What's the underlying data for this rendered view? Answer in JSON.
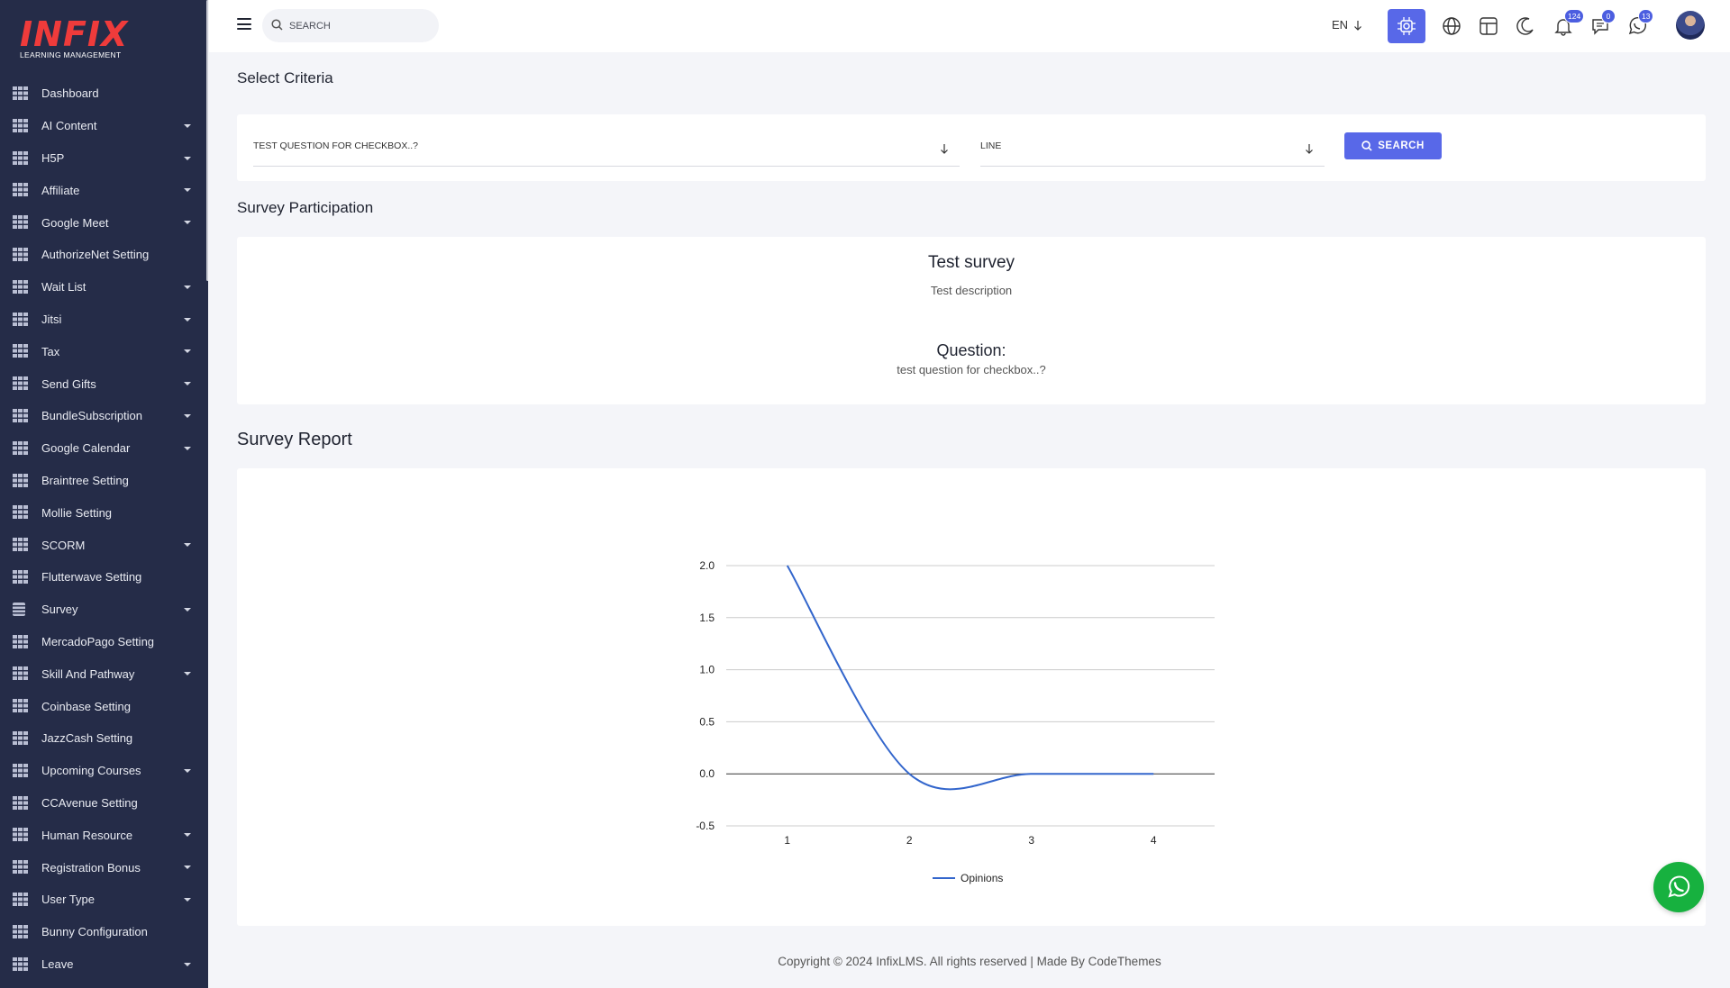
{
  "logo": {
    "brand": "INFIX",
    "tagline": "LEARNING MANAGEMENT"
  },
  "sidebar": {
    "items": [
      {
        "label": "Dashboard",
        "caret": false
      },
      {
        "label": "AI Content",
        "caret": true
      },
      {
        "label": "H5P",
        "caret": true
      },
      {
        "label": "Affiliate",
        "caret": true
      },
      {
        "label": "Google Meet",
        "caret": true
      },
      {
        "label": "AuthorizeNet Setting",
        "caret": false
      },
      {
        "label": "Wait List",
        "caret": true
      },
      {
        "label": "Jitsi",
        "caret": true
      },
      {
        "label": "Tax",
        "caret": true
      },
      {
        "label": "Send Gifts",
        "caret": true
      },
      {
        "label": "BundleSubscription",
        "caret": true
      },
      {
        "label": "Google Calendar",
        "caret": true
      },
      {
        "label": "Braintree Setting",
        "caret": false
      },
      {
        "label": "Mollie Setting",
        "caret": false
      },
      {
        "label": "SCORM",
        "caret": true
      },
      {
        "label": "Flutterwave Setting",
        "caret": false
      },
      {
        "label": "Survey",
        "caret": true,
        "icon": "doc"
      },
      {
        "label": "MercadoPago Setting",
        "caret": false
      },
      {
        "label": "Skill And Pathway",
        "caret": true
      },
      {
        "label": "Coinbase Setting",
        "caret": false
      },
      {
        "label": "JazzCash Setting",
        "caret": false
      },
      {
        "label": "Upcoming Courses",
        "caret": true
      },
      {
        "label": "CCAvenue Setting",
        "caret": false
      },
      {
        "label": "Human Resource",
        "caret": true
      },
      {
        "label": "Registration Bonus",
        "caret": true
      },
      {
        "label": "User Type",
        "caret": true
      },
      {
        "label": "Bunny Configuration",
        "caret": false
      },
      {
        "label": "Leave",
        "caret": true
      }
    ]
  },
  "topbar": {
    "search_placeholder": "SEARCH",
    "language": "EN",
    "notifications_count": "124",
    "messages_count": "0",
    "whatsapp_count": "13"
  },
  "criteria": {
    "title": "Select Criteria",
    "question_select": "TEST QUESTION FOR CHECKBOX..?",
    "chart_type_select": "LINE",
    "search_label": "SEARCH"
  },
  "participation": {
    "title": "Survey Participation",
    "survey_title": "Test survey",
    "survey_description": "Test description",
    "question_label": "Question:",
    "question_text": "test question for checkbox..?"
  },
  "report": {
    "title": "Survey Report"
  },
  "chart_data": {
    "type": "line",
    "x": [
      1,
      2,
      3,
      4
    ],
    "series": [
      {
        "name": "Opinions",
        "values": [
          2,
          0,
          0,
          0
        ],
        "color": "#3366cc"
      }
    ],
    "ylim": [
      -0.5,
      2.0
    ],
    "yticks": [
      "2.0",
      "1.5",
      "1.0",
      "0.5",
      "0.0",
      "-0.5"
    ],
    "xticks": [
      "1",
      "2",
      "3",
      "4"
    ],
    "legend": "bottom",
    "grid": true,
    "smooth": true
  },
  "footer": {
    "text": "Copyright © 2024 InfixLMS. All rights reserved | Made By CodeThemes"
  },
  "colors": {
    "sidebar": "#252c48",
    "accent": "#5868e8",
    "brand": "#ef3b3b",
    "whatsapp": "#17b13f"
  }
}
